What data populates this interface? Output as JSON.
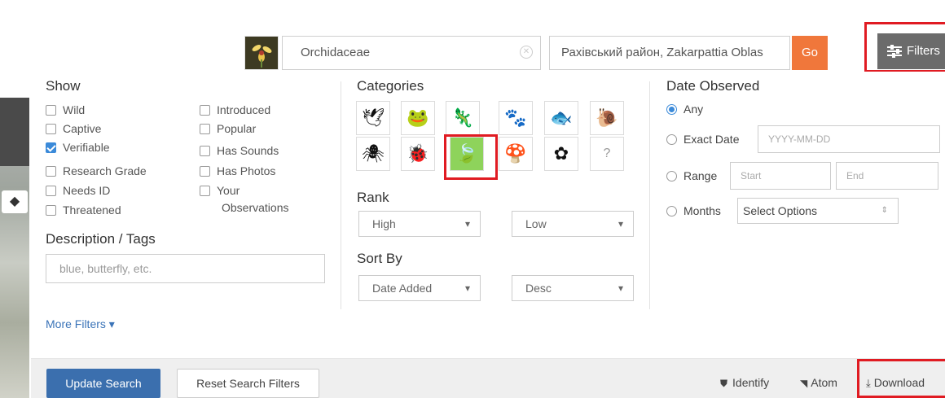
{
  "search": {
    "taxon_value": "Orchidaceae",
    "place_value": "Рахівський район, Zakarpattia Oblas",
    "go_label": "Go",
    "filters_label": "Filters"
  },
  "show": {
    "heading": "Show",
    "left": [
      {
        "label": "Wild",
        "checked": false
      },
      {
        "label": "Captive",
        "checked": false
      },
      {
        "label": "Verifiable",
        "checked": true
      },
      {
        "label": "Research Grade",
        "checked": false
      },
      {
        "label": "Needs ID",
        "checked": false
      },
      {
        "label": "Threatened",
        "checked": false
      }
    ],
    "right": [
      {
        "label": "Introduced",
        "checked": false
      },
      {
        "label": "Popular",
        "checked": false
      },
      {
        "label": "Has Sounds",
        "checked": false
      },
      {
        "label": "Has Photos",
        "checked": false
      },
      {
        "label": "Your",
        "checked": false
      }
    ],
    "your_observations_line2": "Observations"
  },
  "description": {
    "heading": "Description / Tags",
    "placeholder": "blue, butterfly, etc."
  },
  "more_filters_label": "More Filters ▾",
  "categories": {
    "heading": "Categories",
    "icons": [
      "bird-icon",
      "amphibian-icon",
      "reptile-icon",
      "mammal-icon",
      "ray-finned-fish-icon",
      "mollusk-icon",
      "arachnid-icon",
      "insect-icon",
      "plant-icon",
      "fungi-icon",
      "protozoa-icon",
      "unknown-icon"
    ],
    "selected": "plant-icon"
  },
  "rank": {
    "heading": "Rank",
    "high": "High",
    "low": "Low"
  },
  "sort": {
    "heading": "Sort By",
    "field": "Date Added",
    "order": "Desc"
  },
  "date_observed": {
    "heading": "Date Observed",
    "any": "Any",
    "exact": "Exact Date",
    "exact_placeholder": "YYYY-MM-DD",
    "range": "Range",
    "start_placeholder": "Start",
    "end_placeholder": "End",
    "months": "Months",
    "months_select": "Select Options"
  },
  "footer": {
    "update": "Update Search",
    "reset": "Reset Search Filters",
    "identify": "Identify",
    "atom": "Atom",
    "download": "Download"
  },
  "colors": {
    "go": "#f0773b",
    "update": "#3b6fae",
    "selected_category": "#8ed35b",
    "highlight": "#e01b22"
  }
}
